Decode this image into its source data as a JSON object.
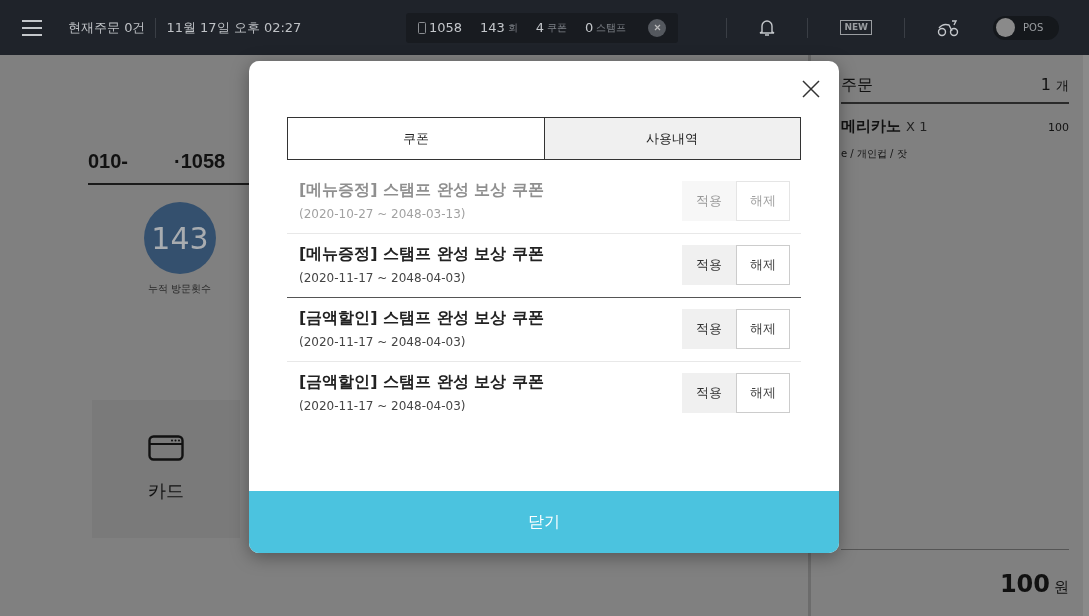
{
  "top_bar": {
    "current_orders": "현재주문 0건",
    "datetime": "11월 17일 오후 02:27",
    "customer_summary": [
      {
        "value": "1058",
        "kind": "phone"
      },
      {
        "value": "143",
        "unit": "회",
        "kind": "plain"
      },
      {
        "value": "4",
        "unit": "쿠폰",
        "kind": "plain"
      },
      {
        "value": "0",
        "unit": "스탬프",
        "kind": "plain"
      }
    ],
    "new_badge": "NEW",
    "pos_toggle": {
      "label": "POS",
      "on": false
    }
  },
  "customer": {
    "phone_prefix": "010-",
    "phone_suffix": "·1058",
    "visit_count": "143",
    "visit_label": "누적 방문횟수"
  },
  "payment_methods": [
    {
      "label": "카드"
    }
  ],
  "order": {
    "title": "주문",
    "count": "1",
    "count_unit": "개",
    "items": [
      {
        "name": "메리카노",
        "qty": "X 1",
        "price": "100",
        "options": "e / 개인컵 / 잣"
      }
    ],
    "total": "100",
    "total_unit": "원"
  },
  "coupon_dialog": {
    "tabs": [
      {
        "label": "쿠폰",
        "selected": true
      },
      {
        "label": "사용내역",
        "selected": false
      }
    ],
    "groups": [
      {
        "coupons": [
          {
            "title": "[메뉴증정] 스탬프 완성 보상 쿠폰",
            "period": "(2020-10-27 ~ 2048-03-13)",
            "disabled": true,
            "apply": "적용",
            "release": "해제"
          },
          {
            "title": "[메뉴증정] 스탬프 완성 보상 쿠폰",
            "period": "(2020-11-17 ~ 2048-04-03)",
            "disabled": false,
            "apply": "적용",
            "release": "해제"
          }
        ]
      },
      {
        "coupons": [
          {
            "title": "[금액할인] 스탬프 완성 보상 쿠폰",
            "period": "(2020-11-17 ~ 2048-04-03)",
            "disabled": false,
            "apply": "적용",
            "release": "해제"
          },
          {
            "title": "[금액할인] 스탬프 완성 보상 쿠폰",
            "period": "(2020-11-17 ~ 2048-04-03)",
            "disabled": false,
            "apply": "적용",
            "release": "해제"
          }
        ]
      }
    ],
    "close_button": "닫기"
  }
}
